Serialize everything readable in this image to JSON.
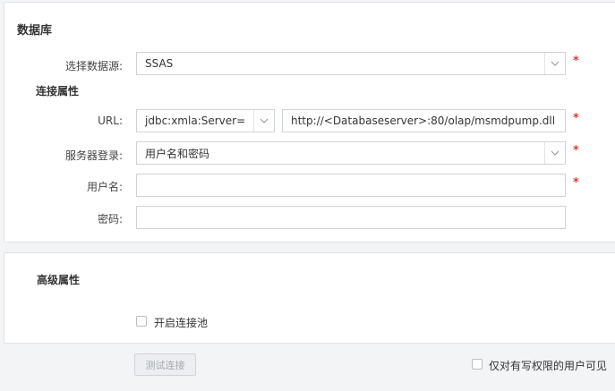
{
  "database": {
    "title": "数据库",
    "datasource_label": "选择数据源:",
    "datasource_value": "SSAS",
    "connection_title": "连接属性",
    "url_label": "URL:",
    "url_prefix_value": "jdbc:xmla:Server=",
    "url_value": "http://<Databaseserver>:80/olap/msmdpump.dll",
    "login_label": "服务器登录:",
    "login_value": "用户名和密码",
    "username_label": "用户名:",
    "username_value": "",
    "password_label": "密码:",
    "password_value": "",
    "required_mark": "*"
  },
  "advanced": {
    "title": "高级属性",
    "pool_label": "开启连接池",
    "pool_checked": false
  },
  "footer": {
    "test_button": "测试连接",
    "write_only_label": "仅对有写权限的用户可见",
    "write_only_checked": false
  },
  "icons": {
    "dropdown": "chevron-down-icon"
  }
}
